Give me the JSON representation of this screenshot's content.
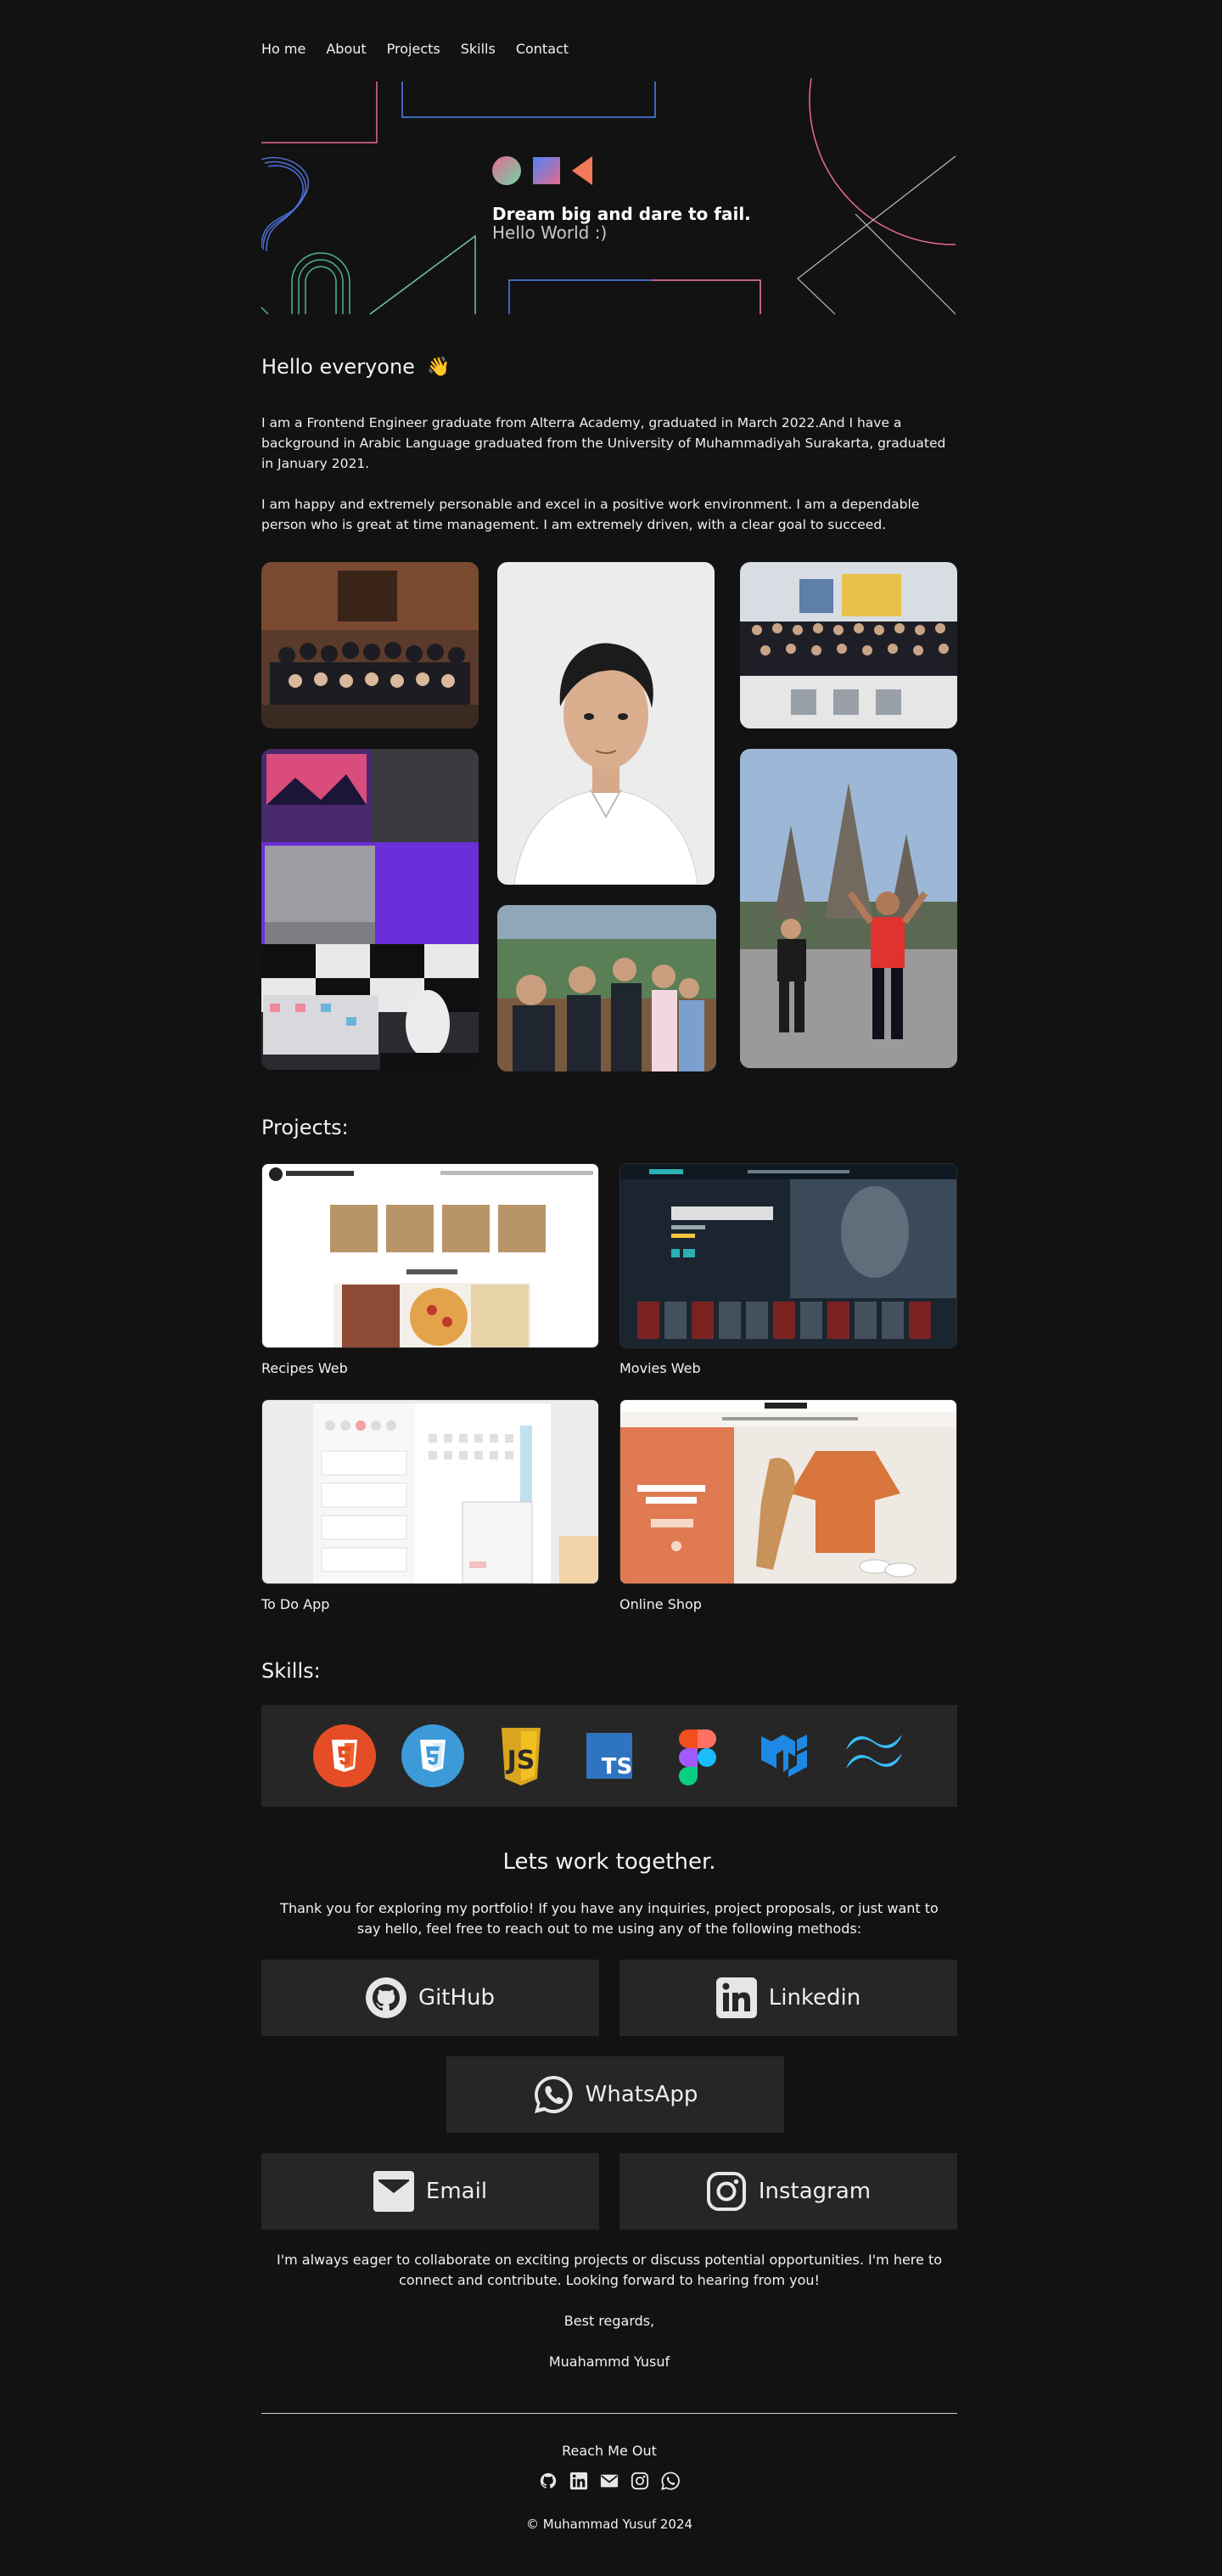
{
  "nav": {
    "items": [
      "Ho me",
      "About",
      "Projects",
      "Skills",
      "Contact"
    ]
  },
  "hero": {
    "tagline": "Dream big and dare to fail.",
    "subtitle": "Hello World :)"
  },
  "about": {
    "greeting": "Hello everyone",
    "wave_emoji": "👋",
    "para1": "I am a Frontend Engineer graduate from Alterra Academy, graduated in March 2022.And I have a background in Arabic Language graduated from the University of Muhammadiyah Surakarta, graduated in January 2021.",
    "para2": "I am happy and extremely personable and excel in a positive work environment. I am a dependable person who is great at time management. I am extremely driven, with a clear goal to succeed."
  },
  "projects": {
    "heading": "Projects:",
    "items": [
      {
        "label": "Recipes Web",
        "icon": "recipes-thumbnail"
      },
      {
        "label": "Movies Web",
        "icon": "movies-thumbnail"
      },
      {
        "label": "To Do App",
        "icon": "todo-thumbnail"
      },
      {
        "label": "Online Shop",
        "icon": "shop-thumbnail"
      }
    ]
  },
  "skills": {
    "heading": "Skills:",
    "icons": [
      "html5-icon",
      "css3-icon",
      "javascript-icon",
      "typescript-icon",
      "figma-icon",
      "material-ui-icon",
      "tailwind-icon"
    ]
  },
  "contact": {
    "title": "Lets work together.",
    "intro": "Thank you for exploring my portfolio! If you have any inquiries, project proposals, or just want to say hello, feel free to reach out to me using any of the following methods:",
    "github": "GitHub",
    "linkedin": "Linkedin",
    "whatsapp": "WhatsApp",
    "email": "Email",
    "instagram": "Instagram",
    "outro": "I'm always eager to collaborate on exciting projects or discuss potential opportunities. I'm here to connect and contribute. Looking forward to hearing from you!",
    "regards": "Best regards,",
    "name": "Muahammd Yusuf"
  },
  "footer": {
    "title": "Reach Me Out",
    "copyright": "© Muhammad Yusuf 2024"
  },
  "colors": {
    "background": "#121212",
    "card": "#262626",
    "text": "#f2f2f2"
  }
}
